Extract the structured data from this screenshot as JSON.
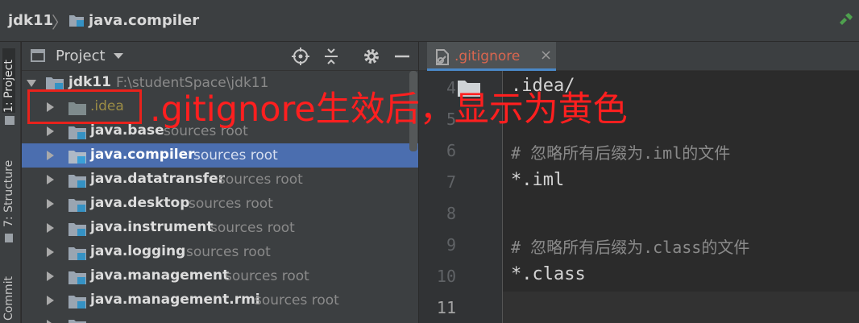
{
  "breadcrumb": {
    "project": "jdk11",
    "separator": "〉",
    "module": "java.compiler"
  },
  "toolstrip": {
    "project_tab": "1: Project",
    "structure_tab": "7: Structure",
    "commit_tab": "Commit"
  },
  "project_panel": {
    "title": "Project",
    "icons": [
      "locate-icon",
      "collapse-icon",
      "gear-icon",
      "minimize-icon"
    ],
    "root": {
      "name": "jdk11",
      "path": "F:\\studentSpace\\jdk11"
    },
    "items": [
      {
        "name": ".idea",
        "suffix": "",
        "ignored": true
      },
      {
        "name": "java.base",
        "suffix": "sources root"
      },
      {
        "name": "java.compiler",
        "suffix": "sources root",
        "selected": true
      },
      {
        "name": "java.datatransfer",
        "suffix": "sources root"
      },
      {
        "name": "java.desktop",
        "suffix": "sources root"
      },
      {
        "name": "java.instrument",
        "suffix": "sources root"
      },
      {
        "name": "java.logging",
        "suffix": "sources root"
      },
      {
        "name": "java.management",
        "suffix": "sources root"
      },
      {
        "name": "java.management.rmi",
        "suffix": "sources root"
      }
    ]
  },
  "editor": {
    "tab_label": ".gitignore",
    "tab_close": "×",
    "line_numbers": [
      "4",
      "5",
      "6",
      "7",
      "8",
      "9",
      "10",
      "11"
    ],
    "lines": [
      ".idea/",
      "",
      "# 忽略所有后缀为.iml的文件",
      "*.iml",
      "",
      "# 忽略所有后缀为.class的文件",
      "*.class",
      ""
    ]
  },
  "annotation": {
    "text": ".gitignore生效后，显示为黄色",
    "color": "#ff1f1f"
  },
  "colors": {
    "selection": "#4b6eaf",
    "ignored_file": "#9b8c45",
    "tab_label": "#d9664f",
    "tab_underline": "#4a88c7"
  }
}
